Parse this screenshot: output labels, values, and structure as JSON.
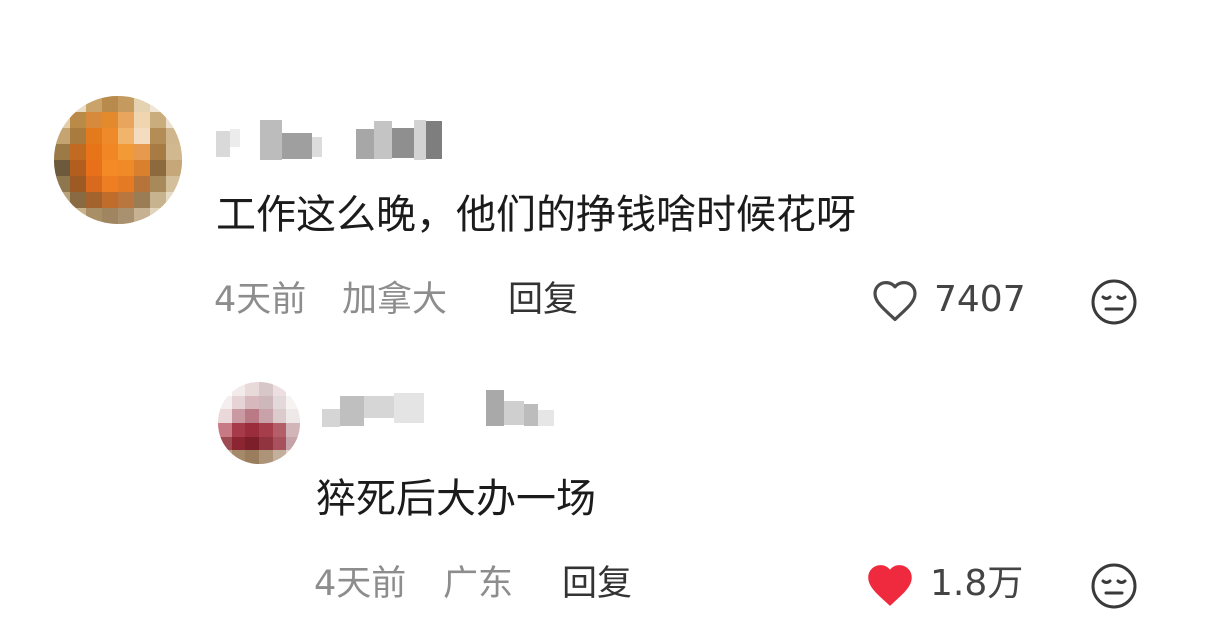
{
  "comments": [
    {
      "text": "工作这么晚，他们的挣钱啥时候花呀",
      "time": "4天前",
      "location": "加拿大",
      "reply_label": "回复",
      "likes": "7407",
      "liked": false
    },
    {
      "text": "猝死后大办一场",
      "time": "4天前",
      "location": "广东",
      "reply_label": "回复",
      "likes": "1.8万",
      "liked": true
    }
  ],
  "colors": {
    "like_active": "#ef2a3f",
    "meta_text": "#8d8d8d",
    "body_text": "#1b1b1b"
  },
  "icons": {
    "like": "heart-outline-icon",
    "liked": "heart-filled-icon",
    "reaction": "meh-face-icon"
  }
}
